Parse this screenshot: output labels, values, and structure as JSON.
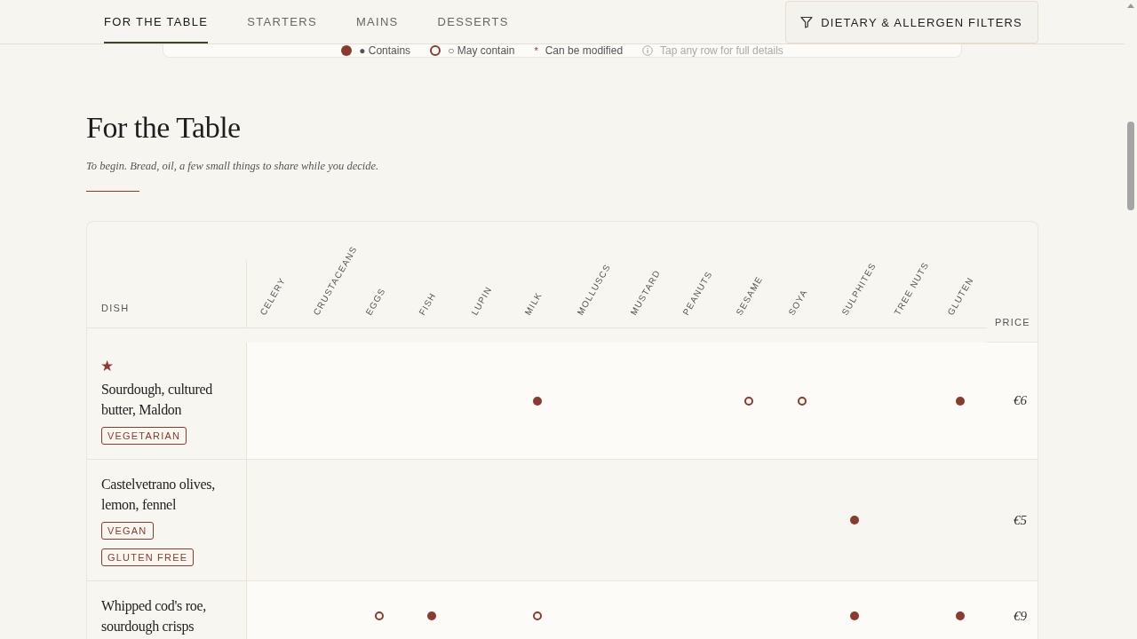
{
  "tabs": [
    {
      "label": "FOR THE TABLE",
      "selected": true
    },
    {
      "label": "STARTERS",
      "selected": false
    },
    {
      "label": "MAINS",
      "selected": false
    },
    {
      "label": "DESSERTS",
      "selected": false
    }
  ],
  "filter_button": {
    "label": "DIETARY & ALLERGEN FILTERS"
  },
  "legend": [
    {
      "kind": "contains",
      "label": "● Contains"
    },
    {
      "kind": "may",
      "label": "○ May contain"
    },
    {
      "kind": "modified",
      "symbol": "*",
      "label": "Can be modified"
    },
    {
      "kind": "info",
      "label": "Tap any row for full details"
    }
  ],
  "section": {
    "title": "For the Table",
    "subtitle": "To begin. Bread, oil, a few small things to share while you decide."
  },
  "table": {
    "dish_header": "DISH",
    "price_header": "PRICE",
    "allergens": [
      "CELERY",
      "CRUSTACEANS",
      "EGGS",
      "FISH",
      "LUPIN",
      "MILK",
      "MOLLUSCS",
      "MUSTARD",
      "PEANUTS",
      "SESAME",
      "SOYA",
      "SULPHITES",
      "TREE NUTS",
      "GLUTEN"
    ],
    "rows": [
      {
        "featured": true,
        "star": "★",
        "dish": "Sourdough, cultured butter, Maldon",
        "tags": [
          "VEGETARIAN"
        ],
        "contains": [
          false,
          false,
          false,
          false,
          false,
          true,
          false,
          false,
          false,
          false,
          false,
          false,
          false,
          true
        ],
        "may_contain": [
          false,
          false,
          false,
          false,
          false,
          false,
          false,
          false,
          false,
          true,
          true,
          false,
          false,
          false
        ],
        "price": "€6"
      },
      {
        "featured": false,
        "dish": "Castelvetrano olives, lemon, fennel",
        "tags": [
          "VEGAN",
          "GLUTEN FREE"
        ],
        "contains": [
          false,
          false,
          false,
          false,
          false,
          false,
          false,
          false,
          false,
          false,
          false,
          true,
          false,
          false
        ],
        "may_contain": [
          false,
          false,
          false,
          false,
          false,
          false,
          false,
          false,
          false,
          false,
          false,
          false,
          false,
          false
        ],
        "price": "€5"
      },
      {
        "featured": false,
        "dish": "Whipped cod's roe, sourdough crisps",
        "contains": [
          false,
          false,
          false,
          true,
          false,
          false,
          false,
          false,
          false,
          false,
          false,
          true,
          false,
          true
        ],
        "may_contain": [
          false,
          false,
          true,
          false,
          false,
          true,
          false,
          false,
          false,
          false,
          false,
          false,
          false,
          false
        ],
        "price": "€9"
      }
    ]
  }
}
